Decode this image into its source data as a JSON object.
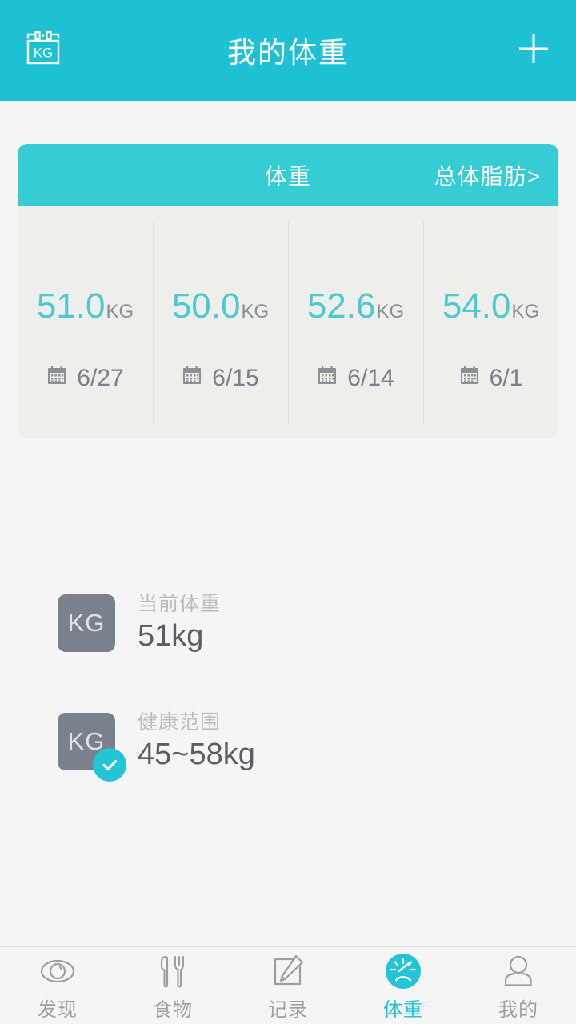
{
  "header": {
    "title": "我的体重",
    "left_icon": "kg-scale-calendar-icon",
    "right_icon": "plus-icon",
    "bg_color": "#1ec1d3"
  },
  "card": {
    "tab_label": "体重",
    "link_label": "总体脂肪>",
    "head_color": "#35ccd3",
    "body_color": "#eeeeea",
    "value_color": "#4cc9d5",
    "entries": [
      {
        "value": "51.0",
        "unit": "KG",
        "date": "6/27"
      },
      {
        "value": "50.0",
        "unit": "KG",
        "date": "6/15"
      },
      {
        "value": "52.6",
        "unit": "KG",
        "date": "6/14"
      },
      {
        "value": "54.0",
        "unit": "KG",
        "date": "6/1"
      }
    ]
  },
  "info": {
    "current": {
      "badge_text": "KG",
      "label": "当前体重",
      "value": "51kg"
    },
    "healthy": {
      "badge_text": "KG",
      "label": "健康范围",
      "value": "45~58kg",
      "check_icon": "check-icon",
      "check_color": "#22c4d6"
    }
  },
  "tabbar": {
    "active_color": "#22c4d6",
    "inactive_color": "#9a9fa5",
    "items": [
      {
        "label": "发现",
        "icon": "eye-icon",
        "active": false
      },
      {
        "label": "食物",
        "icon": "fork-knife-icon",
        "active": false
      },
      {
        "label": "记录",
        "icon": "note-pencil-icon",
        "active": false
      },
      {
        "label": "体重",
        "icon": "weight-gauge-icon",
        "active": true
      },
      {
        "label": "我的",
        "icon": "person-icon",
        "active": false
      }
    ]
  }
}
